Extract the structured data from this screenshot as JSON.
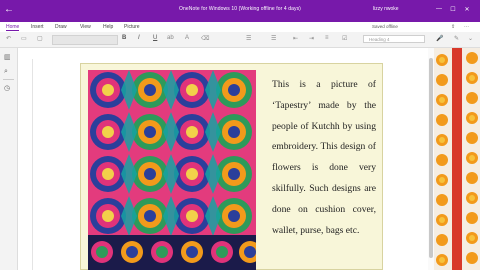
{
  "titlebar": {
    "back_icon": "back-arrow-icon",
    "title": "OneNote for Windows 10 (Working offline for 4 days)",
    "user": "lizzy nwoke",
    "controls": [
      "minimize-icon",
      "maximize-icon",
      "close-icon"
    ],
    "color": "#7719aa"
  },
  "ribbon": {
    "tabs": [
      "Home",
      "Insert",
      "Draw",
      "View",
      "Help",
      "Picture"
    ],
    "active_tab": "Home",
    "saved_status": "Saved offline"
  },
  "toolbar": {
    "undo": "↶",
    "clipboard": "▭",
    "paste": "▢",
    "bold": "B",
    "italic": "I",
    "underline": "U",
    "highlight": "ab",
    "font_color": "A",
    "erase": "⌫",
    "bullets": "☰",
    "numbering": "☰",
    "outdent": "⇤",
    "indent": "⇥",
    "align": "≡",
    "todo": "☑",
    "style_value": "Heading 4",
    "mic": "🎤",
    "pen": "✎",
    "expand": "⌄"
  },
  "leftnav": {
    "icons": [
      "notebooks-icon",
      "search-icon",
      "recent-icon"
    ]
  },
  "document": {
    "paragraph_lines": [
      "This is a picture of",
      "‘Tapestry’ made by the",
      "people of Kutchh by using",
      "embroidery. This design of",
      "flowers is done very",
      "skilfully. Such designs are",
      "done on cushion cover,",
      "wallet, purse, bags etc."
    ],
    "image": "tapestry-embroidery-image"
  },
  "colors": {
    "accent": "#7719aa",
    "doc_bg": "#f8f6d9",
    "tapestry_pink": "#e0337a",
    "tapestry_green": "#2e9a5a",
    "tapestry_blue": "#2b3f9b",
    "marigold": "#f29a1b"
  }
}
